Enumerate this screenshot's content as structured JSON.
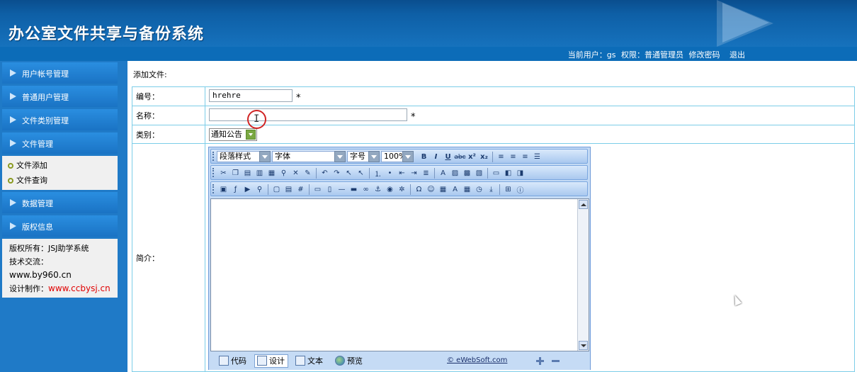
{
  "header": {
    "title": "办公室文件共享与备份系统"
  },
  "userbar": {
    "current_user_label": "当前用户：gs",
    "role_label": "权限：普通管理员",
    "change_password": "修改密码",
    "logout": "退出"
  },
  "sidebar": {
    "items": [
      {
        "label": "用户帐号管理"
      },
      {
        "label": "普通用户管理"
      },
      {
        "label": "文件类别管理"
      },
      {
        "label": "文件管理"
      },
      {
        "label": "数据管理"
      },
      {
        "label": "版权信息"
      }
    ],
    "file_sub": [
      {
        "label": "文件添加"
      },
      {
        "label": "文件查询"
      }
    ],
    "copyright": {
      "owner": "版权所有：JSJ助学系统",
      "tech": "技术交流：",
      "site1": "www.by960.cn",
      "design_label": "设计制作：",
      "design_site": "www.ccbysj.cn"
    }
  },
  "content": {
    "page_label": "添加文件:",
    "form": {
      "number_label": "编号：",
      "number_value": "hrehre",
      "name_label": "名称：",
      "name_value": "",
      "category_label": "类别：",
      "category_value": "通知公告",
      "intro_label": "简介：",
      "required_mark": "*"
    }
  },
  "editor": {
    "paragraph_style": "段落样式",
    "font": "字体",
    "font_size": "字号",
    "zoom": "100%",
    "modes": {
      "code": "代码",
      "design": "设计",
      "text": "文本",
      "preview": "预览"
    },
    "brand": "© eWebSoft.com"
  },
  "colors": {
    "header_blue": "#0e5fa6",
    "sidebar_blue": "#1f7ac7",
    "table_border": "#7ccde8",
    "copyright_red": "#e00000"
  }
}
